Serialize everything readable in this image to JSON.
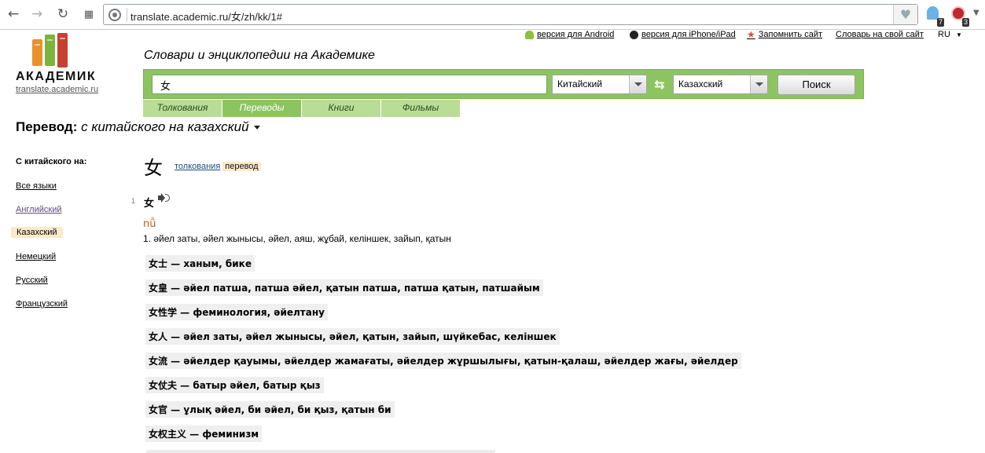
{
  "browser": {
    "url": "translate.academic.ru/女/zh/kk/1#",
    "ghost_badge": "7",
    "adblock_badge": "3"
  },
  "toplinks": {
    "android": "версия для Android",
    "iphone": "версия для iPhone/iPad",
    "bookmark": "Запомнить сайт",
    "dictionary": "Словарь на свой сайт",
    "lang": "RU"
  },
  "logo": {
    "name": "АКАДЕМИК",
    "url": "translate.academic.ru"
  },
  "header": {
    "site_title": "Словари и энциклопедии на Академике",
    "search_value": "女",
    "from_lang": "Китайский",
    "to_lang": "Казахский",
    "search_button": "Поиск"
  },
  "tabs": [
    {
      "label": "Толкования",
      "active": false
    },
    {
      "label": "Переводы",
      "active": true
    },
    {
      "label": "Книги",
      "active": false
    },
    {
      "label": "Фильмы",
      "active": false
    }
  ],
  "page": {
    "heading_label": "Перевод:",
    "heading_direction": "с китайского на казахский"
  },
  "sidebar": {
    "heading": "С китайского на:",
    "items": [
      {
        "label": "Все языки"
      },
      {
        "label": "Английский"
      },
      {
        "label": "Казахский"
      },
      {
        "label": "Немецкий"
      },
      {
        "label": "Русский"
      },
      {
        "label": "Французский"
      }
    ]
  },
  "entry": {
    "headword": "女",
    "link_definitions": "толкования",
    "link_translation": "перевод",
    "number": "1",
    "word": "女",
    "pinyin": "nǚ",
    "definition": "1. әйел заты, әйел жынысы, әйел, аяш, жұбай, келіншек, зайып, қатын",
    "phrases": [
      "女士 — ханым, бике",
      "女皇 — әйел патша, патша әйел, қатын патша, патша қатын, патшайым",
      "女性学 — феминология, әйелтану",
      "女人 — әйел заты, әйел жынысы, әйел, қатын, зайып, шүйкебас, келіншек",
      "女流 — әйелдер қауымы, әйелдер жамағаты, әйелдер жұршылығы, қатын-қалаш, әйелдер жағы, әйелдер",
      "女仗夫 — батыр әйел, батыр қыз",
      "女官 — ұлық әйел, би әйел, би қыз, қатын би",
      "女权主义 — феминизм"
    ]
  }
}
